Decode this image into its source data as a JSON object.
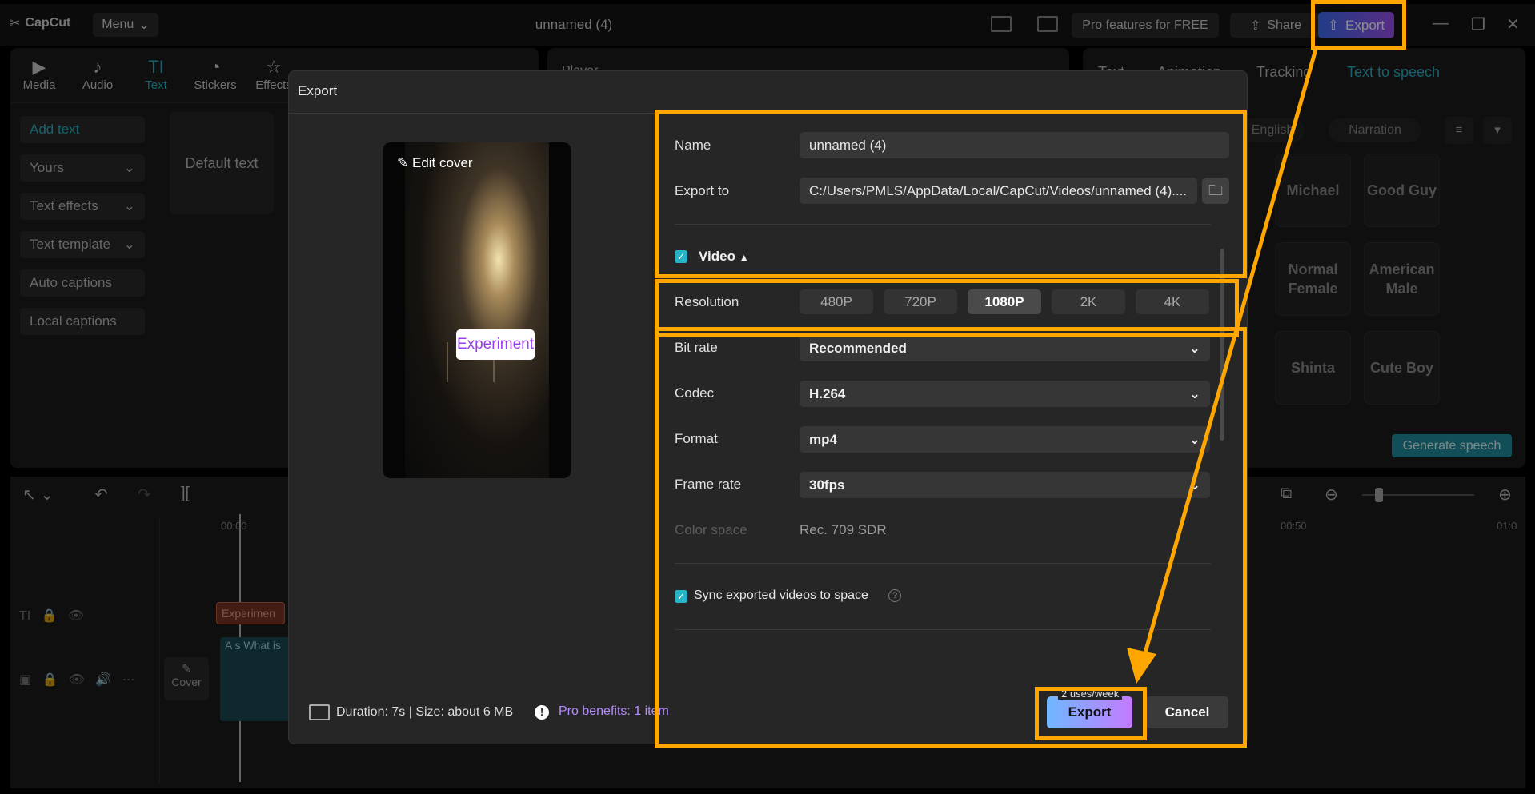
{
  "app": {
    "logo": "CapCut",
    "menu_label": "Menu",
    "title": "unnamed (4)"
  },
  "topbar": {
    "pro_label": "Pro features for FREE",
    "share_label": "Share",
    "export_label": "Export"
  },
  "toolbar": {
    "items": [
      "Media",
      "Audio",
      "Text",
      "Stickers",
      "Effects"
    ]
  },
  "sidebar": {
    "items": [
      "Add text",
      "Yours",
      "Text effects",
      "Text template",
      "Auto captions",
      "Local captions"
    ]
  },
  "text_panel": {
    "default_text": "Default text"
  },
  "player": {
    "label": "Player"
  },
  "right_panel": {
    "tabs": [
      "Text",
      "Animation",
      "Tracking",
      "Text to speech"
    ],
    "filters": [
      "English",
      "Narration"
    ],
    "voices": [
      "Michael",
      "Good Guy",
      "Normal Female",
      "American Male",
      "Shinta",
      "Cute Boy"
    ],
    "generate_label": "Generate speech"
  },
  "timeline": {
    "time_start": "00:00",
    "time_50": "00:50",
    "time_end": "01:0",
    "text_clip": "Experimen",
    "video_clip_text": "A s  What is",
    "cover_label": "Cover"
  },
  "dialog": {
    "title": "Export",
    "edit_cover": "Edit cover",
    "cover_caption": "Experiment",
    "name_label": "Name",
    "name_value": "unnamed (4)",
    "export_to_label": "Export to",
    "export_to_value": "C:/Users/PMLS/AppData/Local/CapCut/Videos/unnamed (4)....",
    "video_label": "Video",
    "resolution_label": "Resolution",
    "resolutions": [
      "480P",
      "720P",
      "1080P",
      "2K",
      "4K"
    ],
    "selected_resolution": "1080P",
    "bitrate_label": "Bit rate",
    "bitrate_value": "Recommended",
    "codec_label": "Codec",
    "codec_value": "H.264",
    "format_label": "Format",
    "format_value": "mp4",
    "framerate_label": "Frame rate",
    "framerate_value": "30fps",
    "colorspace_label": "Color space",
    "colorspace_value": "Rec. 709 SDR",
    "sync_label": "Sync exported videos to space",
    "duration_text": "Duration: 7s | Size: about 6 MB",
    "pro_benefits": "Pro benefits: 1 item",
    "uses_badge": "2 uses/week",
    "export_label": "Export",
    "cancel_label": "Cancel"
  },
  "colors": {
    "accent": "#27b4c8",
    "highlight": "#ffa600",
    "export_gradient_start": "#6fb8ff",
    "export_gradient_end": "#c47bff"
  }
}
